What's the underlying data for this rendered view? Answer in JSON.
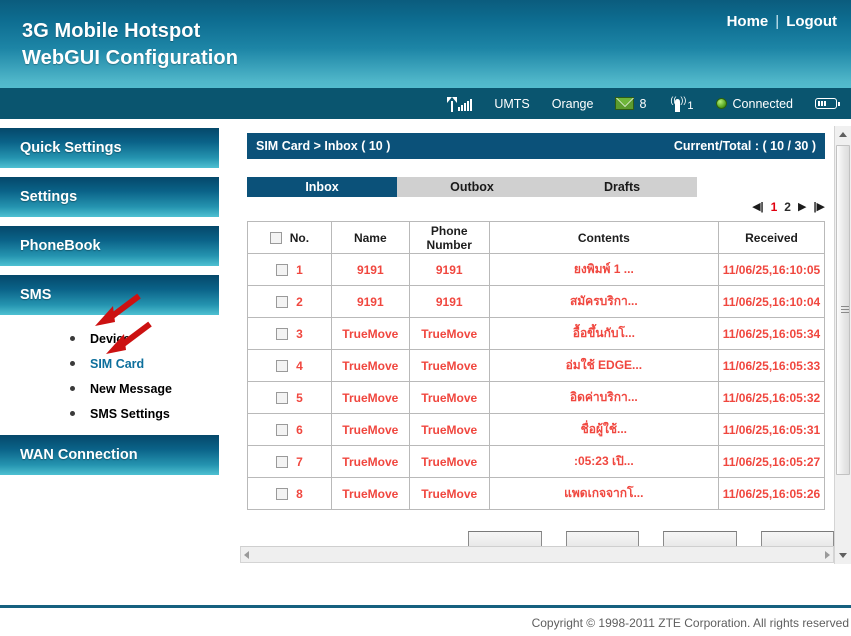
{
  "header": {
    "brand_line1": "3G Mobile Hotspot",
    "brand_line2": "WebGUI Configuration",
    "home_label": "Home",
    "separator": "|",
    "logout_label": "Logout"
  },
  "status_bar": {
    "signal_icon": "signal-bars-icon",
    "network_type": "UMTS",
    "operator": "Orange",
    "message_icon": "envelope-icon",
    "message_count": "8",
    "wifi_icon": "wifi-antenna-icon",
    "wifi_clients": "1",
    "connection_status_icon": "green-status-dot",
    "connection_status": "Connected",
    "battery_icon": "battery-icon"
  },
  "sidebar": {
    "items": [
      {
        "label": "Quick Settings",
        "type": "head"
      },
      {
        "label": "Settings",
        "type": "head"
      },
      {
        "label": "PhoneBook",
        "type": "head"
      },
      {
        "label": "SMS",
        "type": "head"
      },
      {
        "label": "WAN Connection",
        "type": "head"
      }
    ],
    "sms_submenu": [
      {
        "label": "Device",
        "active": false
      },
      {
        "label": "SIM Card",
        "active": true
      },
      {
        "label": "New Message",
        "active": false
      },
      {
        "label": "SMS Settings",
        "active": false
      }
    ],
    "annotations": [
      {
        "name": "arrow-to-device",
        "color": "#cc1111"
      },
      {
        "name": "arrow-to-sim-card",
        "color": "#cc1111"
      }
    ]
  },
  "main": {
    "breadcrumb": "SIM Card > Inbox ( 10 )",
    "counter": "Current/Total : ( 10 / 30 )",
    "tabs": [
      {
        "label": "Inbox",
        "active": true
      },
      {
        "label": "Outbox",
        "active": false
      },
      {
        "label": "Drafts",
        "active": false
      }
    ],
    "pagination": {
      "first_icon": "first-page-icon",
      "first_glyph": "◀|",
      "pages": [
        {
          "label": "1",
          "current": true
        },
        {
          "label": "2",
          "current": false
        }
      ],
      "next_glyph": "▶",
      "last_glyph": "|▶"
    },
    "table": {
      "select_all_checkbox": "select-all-checkbox",
      "columns": [
        "No.",
        "Name",
        "Phone Number",
        "Contents",
        "Received"
      ],
      "rows": [
        {
          "no": "1",
          "name": "9191",
          "phone": "9191",
          "contents": "ยงพิมพ์ 1 ...",
          "received": "11/06/25,16:10:05"
        },
        {
          "no": "2",
          "name": "9191",
          "phone": "9191",
          "contents": "สมัครบริกา...",
          "received": "11/06/25,16:10:04"
        },
        {
          "no": "3",
          "name": "TrueMove",
          "phone": "TrueMove",
          "contents": "อื้อขึ้นกับโ...",
          "received": "11/06/25,16:05:34"
        },
        {
          "no": "4",
          "name": "TrueMove",
          "phone": "TrueMove",
          "contents": "อ่มใช้ EDGE...",
          "received": "11/06/25,16:05:33"
        },
        {
          "no": "5",
          "name": "TrueMove",
          "phone": "TrueMove",
          "contents": "อิดค่าบริกา...",
          "received": "11/06/25,16:05:32"
        },
        {
          "no": "6",
          "name": "TrueMove",
          "phone": "TrueMove",
          "contents": "ชื่อผู้ใช้...",
          "received": "11/06/25,16:05:31"
        },
        {
          "no": "7",
          "name": "TrueMove",
          "phone": "TrueMove",
          "contents": ":05:23 เปิ...",
          "received": "11/06/25,16:05:27"
        },
        {
          "no": "8",
          "name": "TrueMove",
          "phone": "TrueMove",
          "contents": "แพดเกจจากโ...",
          "received": "11/06/25,16:05:26"
        }
      ]
    },
    "action_buttons": [
      {
        "name": "action-button-1",
        "label": ""
      },
      {
        "name": "action-button-2",
        "label": ""
      },
      {
        "name": "action-button-3",
        "label": ""
      },
      {
        "name": "action-button-4",
        "label": ""
      }
    ]
  },
  "footer": {
    "copyright": "Copyright © 1998-2011 ZTE Corporation. All rights reserved"
  },
  "colors": {
    "header_dark": "#0b5c7d",
    "header_light": "#53bcce",
    "panel_blue": "#0b5179",
    "accent_red": "#e1000f",
    "row_text_red": "#f0473f",
    "active_link": "#0d6f9c"
  }
}
